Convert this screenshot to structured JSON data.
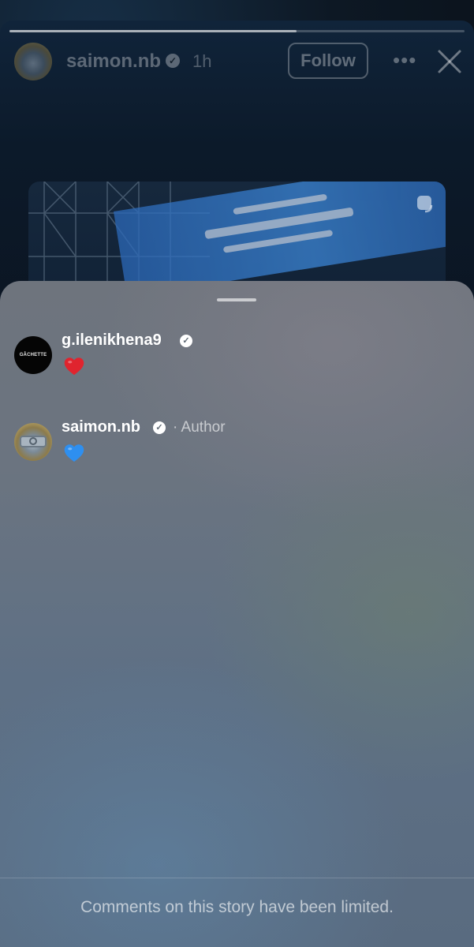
{
  "story": {
    "username": "saimon.nb",
    "time": "1h",
    "follow_label": "Follow",
    "more_glyph": "•••",
    "progress": 0.63,
    "icons": {
      "verified": "verified-badge-icon",
      "more": "more-options-icon",
      "close": "close-icon",
      "media": "sticker-icon"
    }
  },
  "comments": [
    {
      "username": "g.ilenikhena9",
      "avatar_text": "GÂCHETTE",
      "verified": true,
      "author_tag": "",
      "reaction": "red-heart-emoji",
      "reaction_color": "#e0242e"
    },
    {
      "username": "saimon.nb",
      "avatar_text": "",
      "verified": true,
      "author_tag": "· Author",
      "reaction": "blue-heart-emoji",
      "reaction_color": "#2e8ff0"
    }
  ],
  "footer": {
    "notice": "Comments on this story have been limited."
  }
}
